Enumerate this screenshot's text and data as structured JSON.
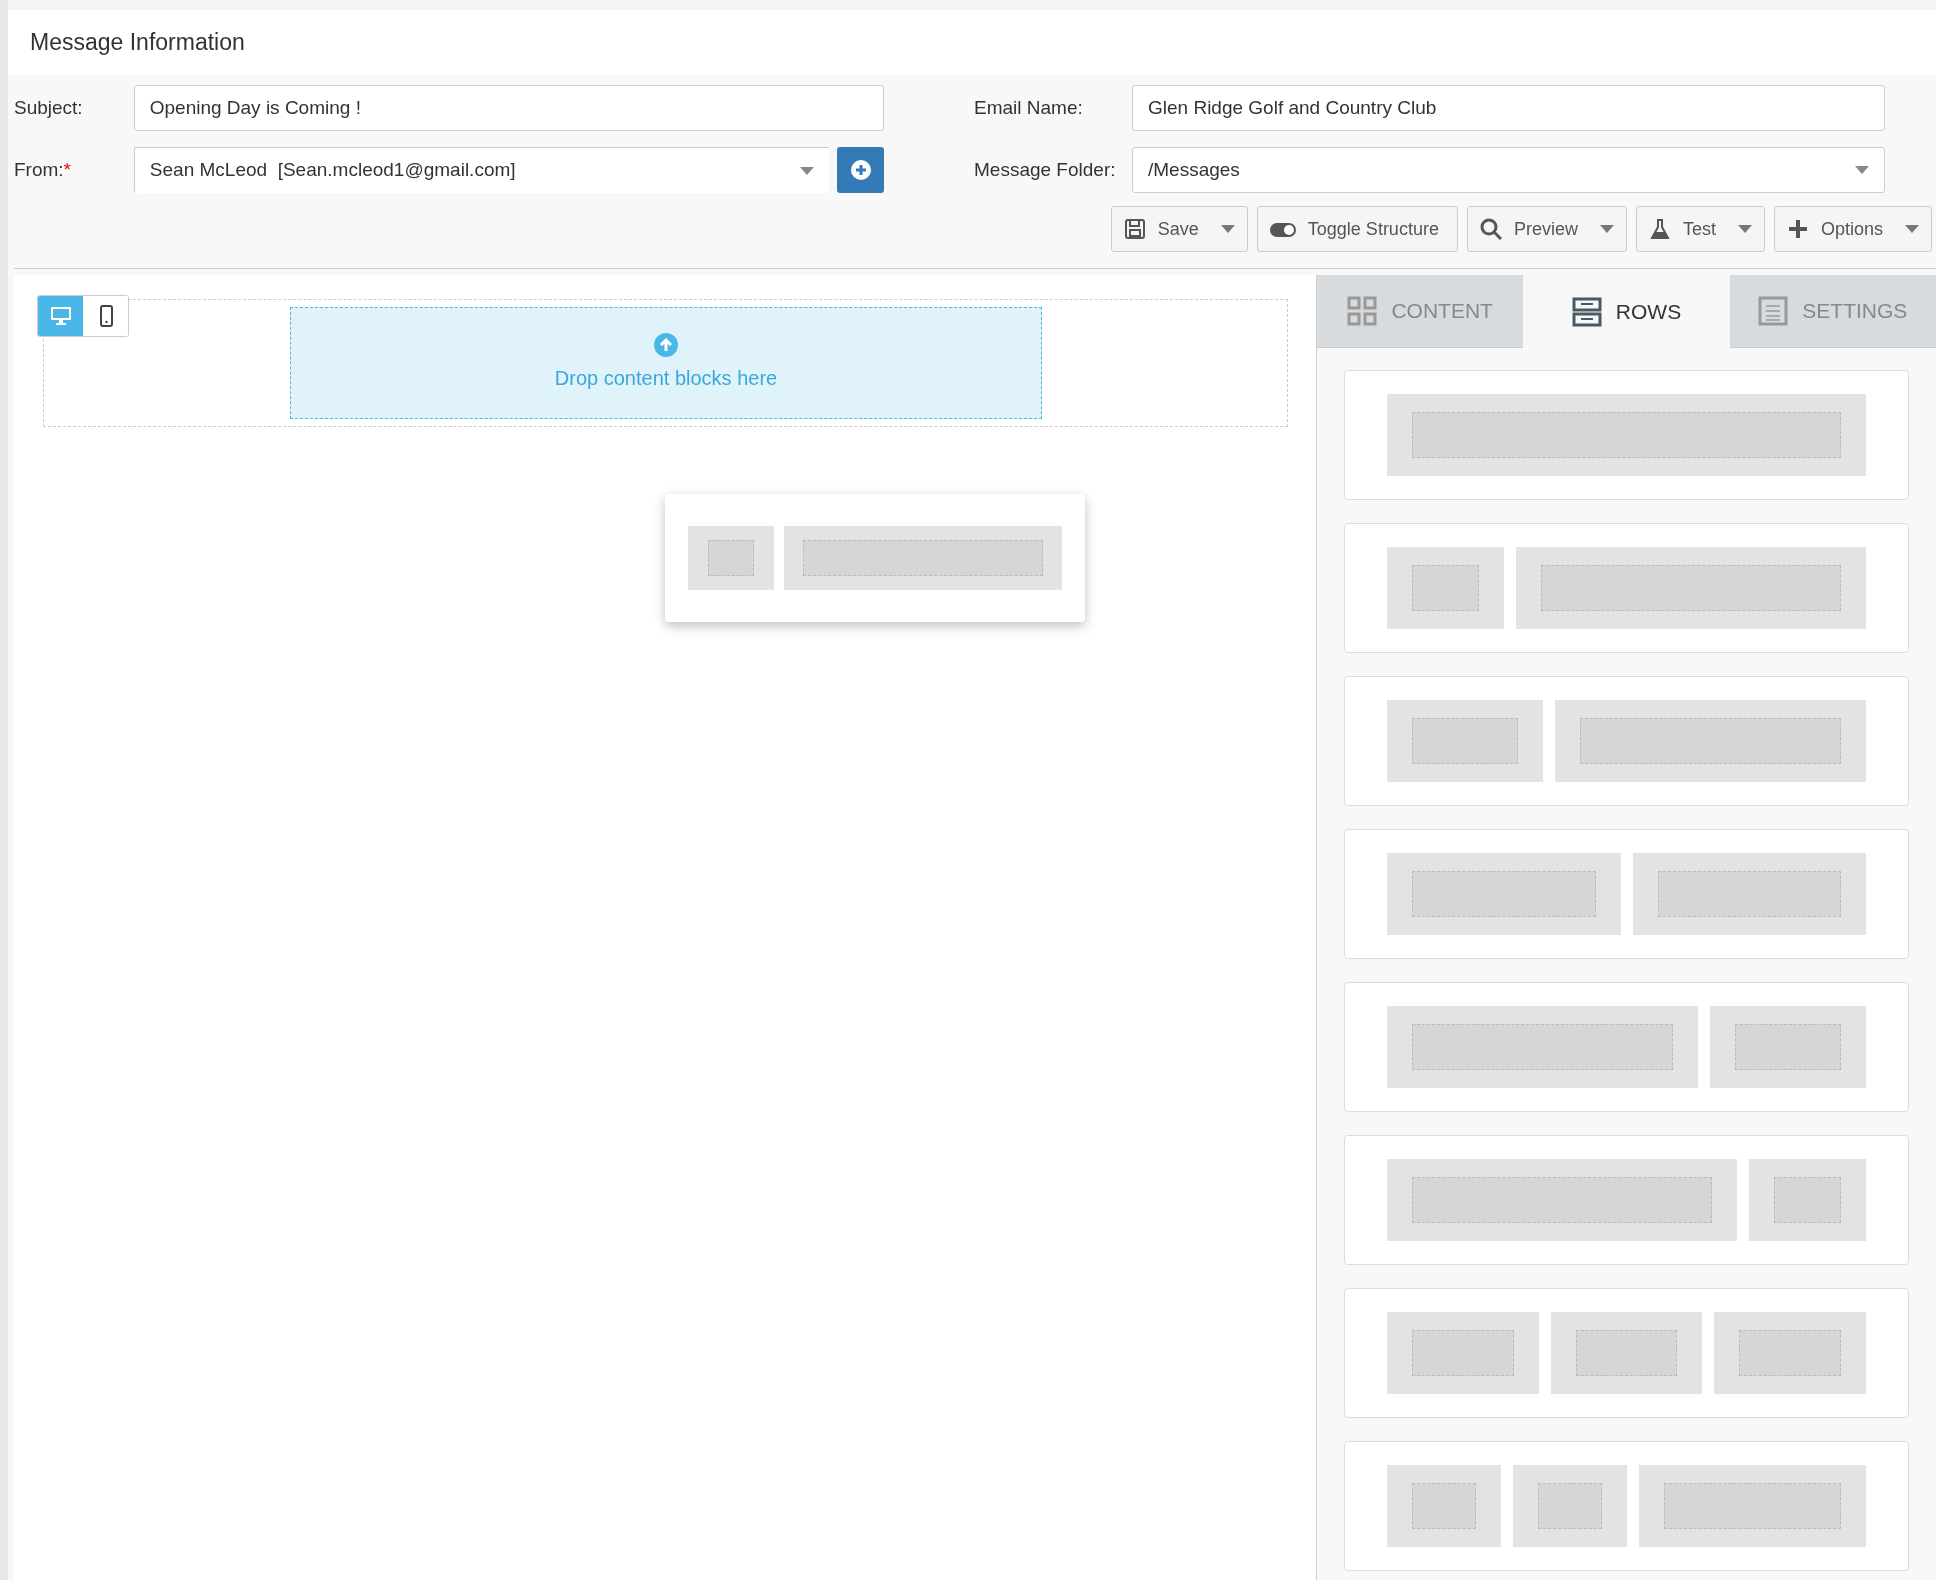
{
  "header": {
    "title": "Message Information"
  },
  "fields": {
    "subject": {
      "label": "Subject:",
      "value": "Opening Day is Coming !"
    },
    "from": {
      "label": "From:",
      "required_mark": "*",
      "value": "Sean McLeod  [Sean.mcleod1@gmail.com]"
    },
    "email_name": {
      "label": "Email Name:",
      "value": "Glen Ridge Golf and Country Club"
    },
    "message_folder": {
      "label": "Message Folder:",
      "value": "/Messages"
    }
  },
  "toolbar": [
    {
      "label": "Save",
      "dropdown": true
    },
    {
      "label": "Toggle Structure",
      "dropdown": false
    },
    {
      "label": "Preview",
      "dropdown": true
    },
    {
      "label": "Test",
      "dropdown": true
    },
    {
      "label": "Options",
      "dropdown": true
    }
  ],
  "device_toggle": [
    {
      "selected": true
    },
    {
      "selected": false
    }
  ],
  "drop_zone": {
    "text": "Drop content blocks here"
  },
  "tabs": [
    {
      "label": "CONTENT",
      "selected": false
    },
    {
      "label": "ROWS",
      "selected": true
    },
    {
      "label": "SETTINGS",
      "selected": false
    }
  ]
}
